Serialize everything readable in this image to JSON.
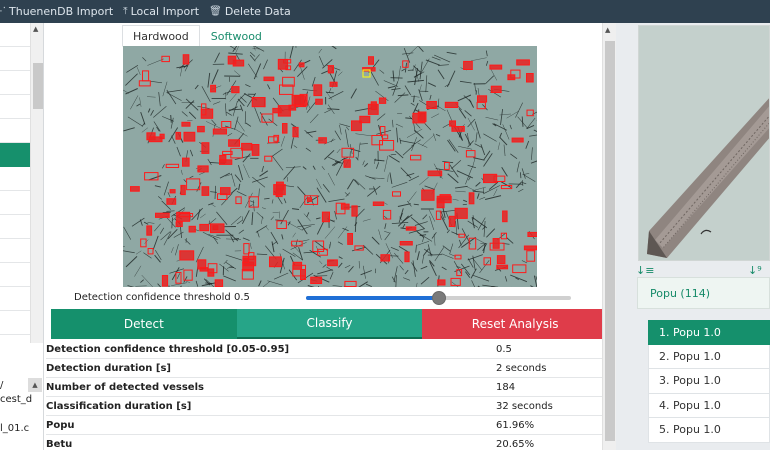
{
  "toolbar": {
    "items": [
      {
        "label": "ThuenenDB Import",
        "icon": "dots-icon"
      },
      {
        "label": "Local Import",
        "icon": "upload-icon"
      },
      {
        "label": "Delete Data",
        "icon": "trash-icon"
      }
    ]
  },
  "left_panel": {
    "path_lines": [
      "/",
      "cest_d",
      "l_01.c"
    ]
  },
  "tabs": [
    "Hardwood",
    "Softwood"
  ],
  "threshold": {
    "label": "Detection confidence threshold 0.5",
    "value": 0.5,
    "min": 0.05,
    "max": 0.95
  },
  "buttons": {
    "detect": "Detect",
    "classify": "Classify",
    "reset": "Reset Analysis"
  },
  "results": [
    {
      "key": "Detection confidence threshold [0.05-0.95]",
      "value": "0.5"
    },
    {
      "key": "Detection duration [s]",
      "value": "2 seconds"
    },
    {
      "key": "Number of detected vessels",
      "value": "184"
    },
    {
      "key": "Classification duration [s]",
      "value": "32 seconds"
    },
    {
      "key": "Popu",
      "value": "61.96%"
    },
    {
      "key": "Betu",
      "value": "20.65%"
    }
  ],
  "right_panel": {
    "group_label": "Popu (114)",
    "predictions": [
      "1. Popu 1.0",
      "2. Popu 1.0",
      "3. Popu 1.0",
      "4. Popu 1.0",
      "5. Popu 1.0"
    ]
  },
  "colors": {
    "accent_green": "#15906c",
    "reset_red": "#df3c4a",
    "topbar": "#2f4150"
  }
}
